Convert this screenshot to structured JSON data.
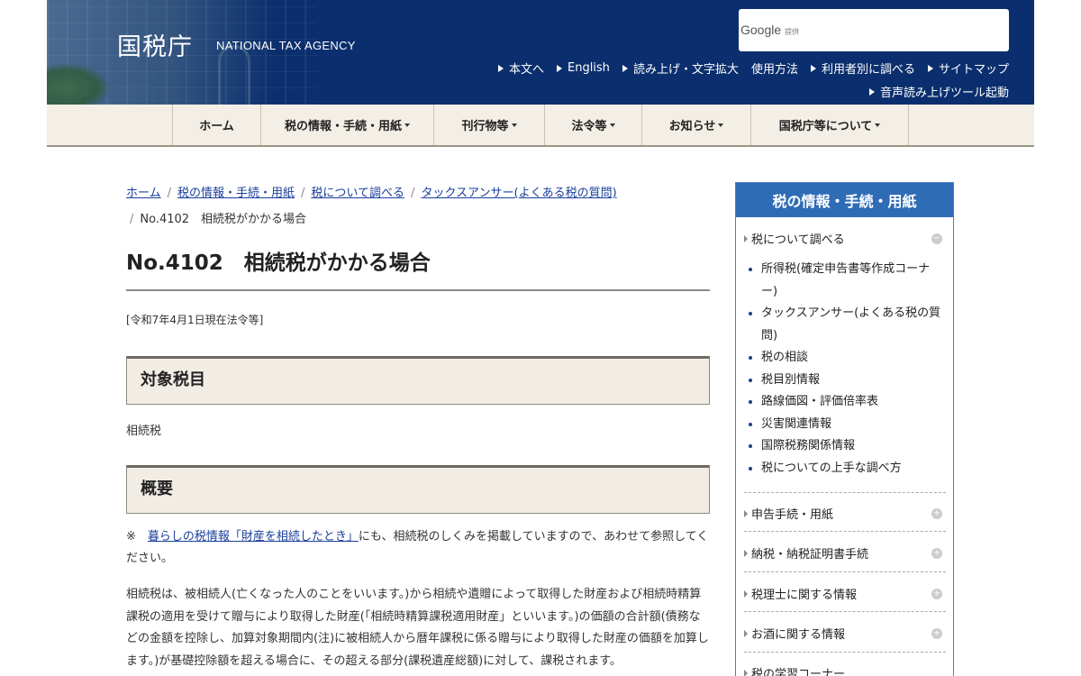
{
  "header": {
    "logo": "国税庁",
    "logo_en": "NATIONAL TAX AGENCY",
    "search_brand": "Google",
    "search_sub": "提供",
    "top_links": [
      "本文へ",
      "English",
      "読み上げ・文字拡大",
      "使用方法",
      "利用者別に調べる",
      "サイトマップ"
    ],
    "voice_link": "音声読み上げツール起動"
  },
  "gnav": {
    "items": [
      {
        "label": "ホーム"
      },
      {
        "label": "税の情報・手続・用紙"
      },
      {
        "label": "刊行物等"
      },
      {
        "label": "法令等"
      },
      {
        "label": "お知らせ"
      },
      {
        "label": "国税庁等について"
      }
    ]
  },
  "breadcrumb": {
    "items": [
      "ホーム",
      "税の情報・手続・用紙",
      "税について調べる",
      "タックスアンサー(よくある税の質問)"
    ],
    "current": "No.4102　相続税がかかる場合"
  },
  "main": {
    "title": "No.4102　相続税がかかる場合",
    "law_date": "[令和7年4月1日現在法令等]",
    "section1_heading": "対象税目",
    "section1_text": "相続税",
    "section2_heading": "概要",
    "note_prefix": "※　",
    "note_link": "暮らしの税情報「財産を相続したとき」",
    "note_rest": "にも、相続税のしくみを掲載していますので、あわせて参照してください。",
    "paragraph": "相続税は、被相続人(亡くなった人のことをいいます。)から相続や遺贈によって取得した財産および相続時精算課税の適用を受けて贈与により取得した財産(「相続時精算課税適用財産」といいます。)の価額の合計額(債務などの金額を控除し、加算対象期間内(注)に被相続人から暦年課税に係る贈与により取得した財産の価額を加算します。)が基礎控除額を超える場合に、その超える部分(課税遺産総額)に対して、課税されます。"
  },
  "sidebar": {
    "heading": "税の情報・手続・用紙",
    "cat1": "税について調べる",
    "list": [
      "所得税(確定申告書等作成コーナー)",
      "タックスアンサー(よくある税の質問)",
      "税の相談",
      "税目別情報",
      "路線価図・評価倍率表",
      "災害関連情報",
      "国際税務関係情報",
      "税についての上手な調べ方"
    ],
    "cat2": "申告手続・用紙",
    "cat3": "納税・納税証明書手続",
    "cat4": "税理士に関する情報",
    "cat5": "お酒に関する情報",
    "cat6": "税の学習コーナー"
  }
}
